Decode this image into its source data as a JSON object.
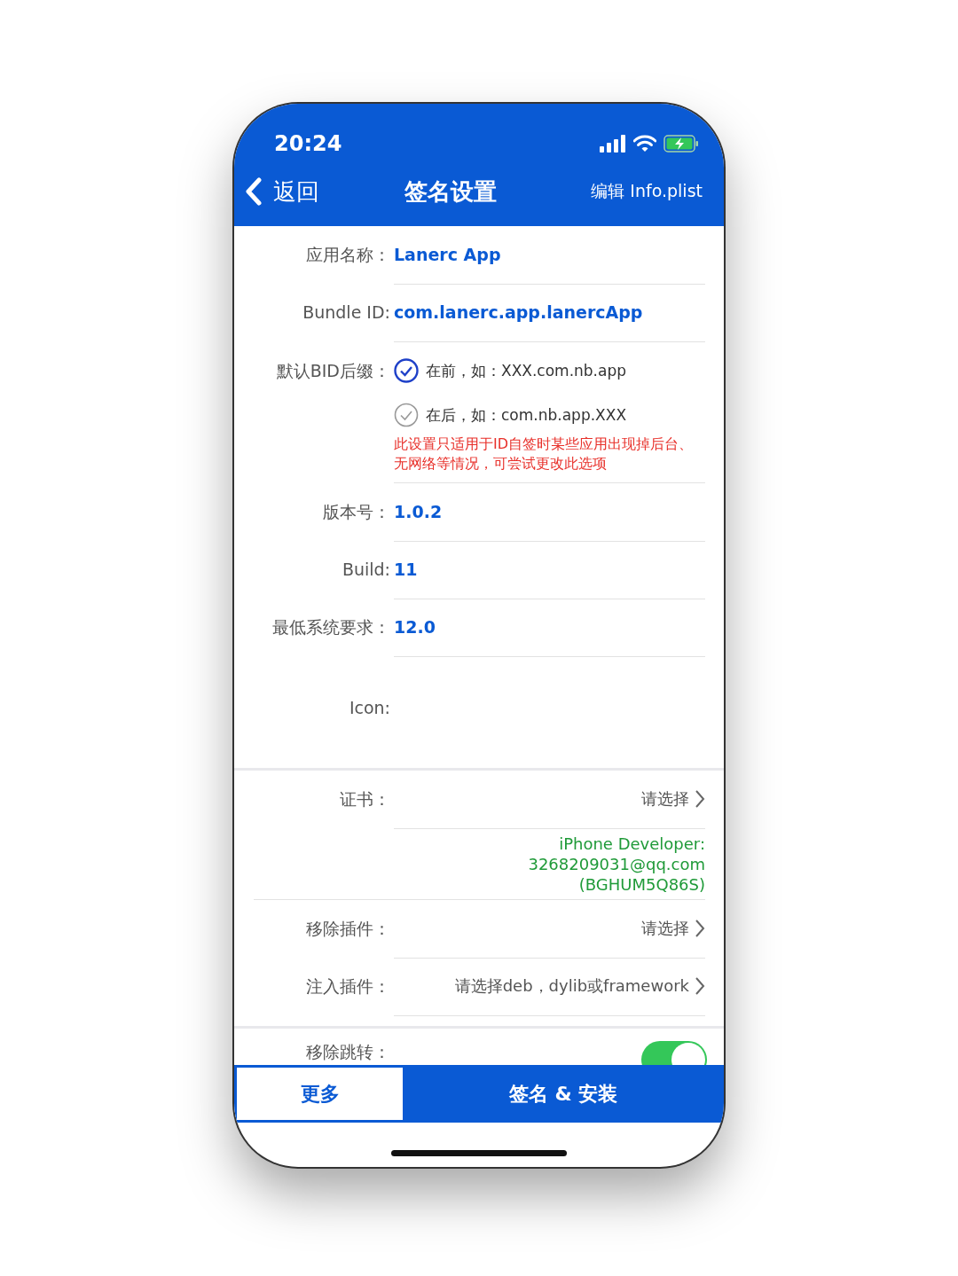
{
  "status_bar": {
    "time": "20:24"
  },
  "nav": {
    "back": "返回",
    "title": "签名设置",
    "action": "编辑 Info.plist"
  },
  "sections": [
    {
      "rows": [
        {
          "kind": "value",
          "label": "应用名称：",
          "value": "Lanerc App"
        },
        {
          "kind": "value",
          "label": "Bundle ID:",
          "value": "com.lanerc.app.lanercApp"
        },
        {
          "kind": "radio",
          "label": "默认BID后缀：",
          "options": [
            {
              "label": "在前，如：XXX.com.nb.app",
              "selected": true
            },
            {
              "label": "在后，如：com.nb.app.XXX",
              "selected": false
            }
          ],
          "note": "此设置只适用于ID自签时某些应用出现掉后台、无网络等情况，可尝试更改此选项"
        },
        {
          "kind": "value",
          "label": "版本号：",
          "value": "1.0.2"
        },
        {
          "kind": "value",
          "label": "Build:",
          "value": "11"
        },
        {
          "kind": "value",
          "label": "最低系统要求：",
          "value": "12.0"
        },
        {
          "kind": "icon",
          "label": "Icon:"
        }
      ]
    },
    {
      "rows": [
        {
          "kind": "picker",
          "label": "证书：",
          "value": "请选择"
        },
        {
          "kind": "detail",
          "lines": [
            "iPhone Developer:",
            "3268209031@qq.com",
            "(BGHUM5Q86S)"
          ]
        },
        {
          "kind": "picker",
          "label": "移除插件：",
          "value": "请选择"
        },
        {
          "kind": "picker",
          "label": "注入插件：",
          "value": "请选择deb，dylib或framework"
        }
      ]
    },
    {
      "rows": [
        {
          "kind": "toggle",
          "label": "移除跳转：",
          "on": true
        }
      ]
    }
  ],
  "footer": [
    {
      "kind": "secondary",
      "label": "更多"
    },
    {
      "kind": "primary",
      "label": "签名 & 安装"
    }
  ]
}
